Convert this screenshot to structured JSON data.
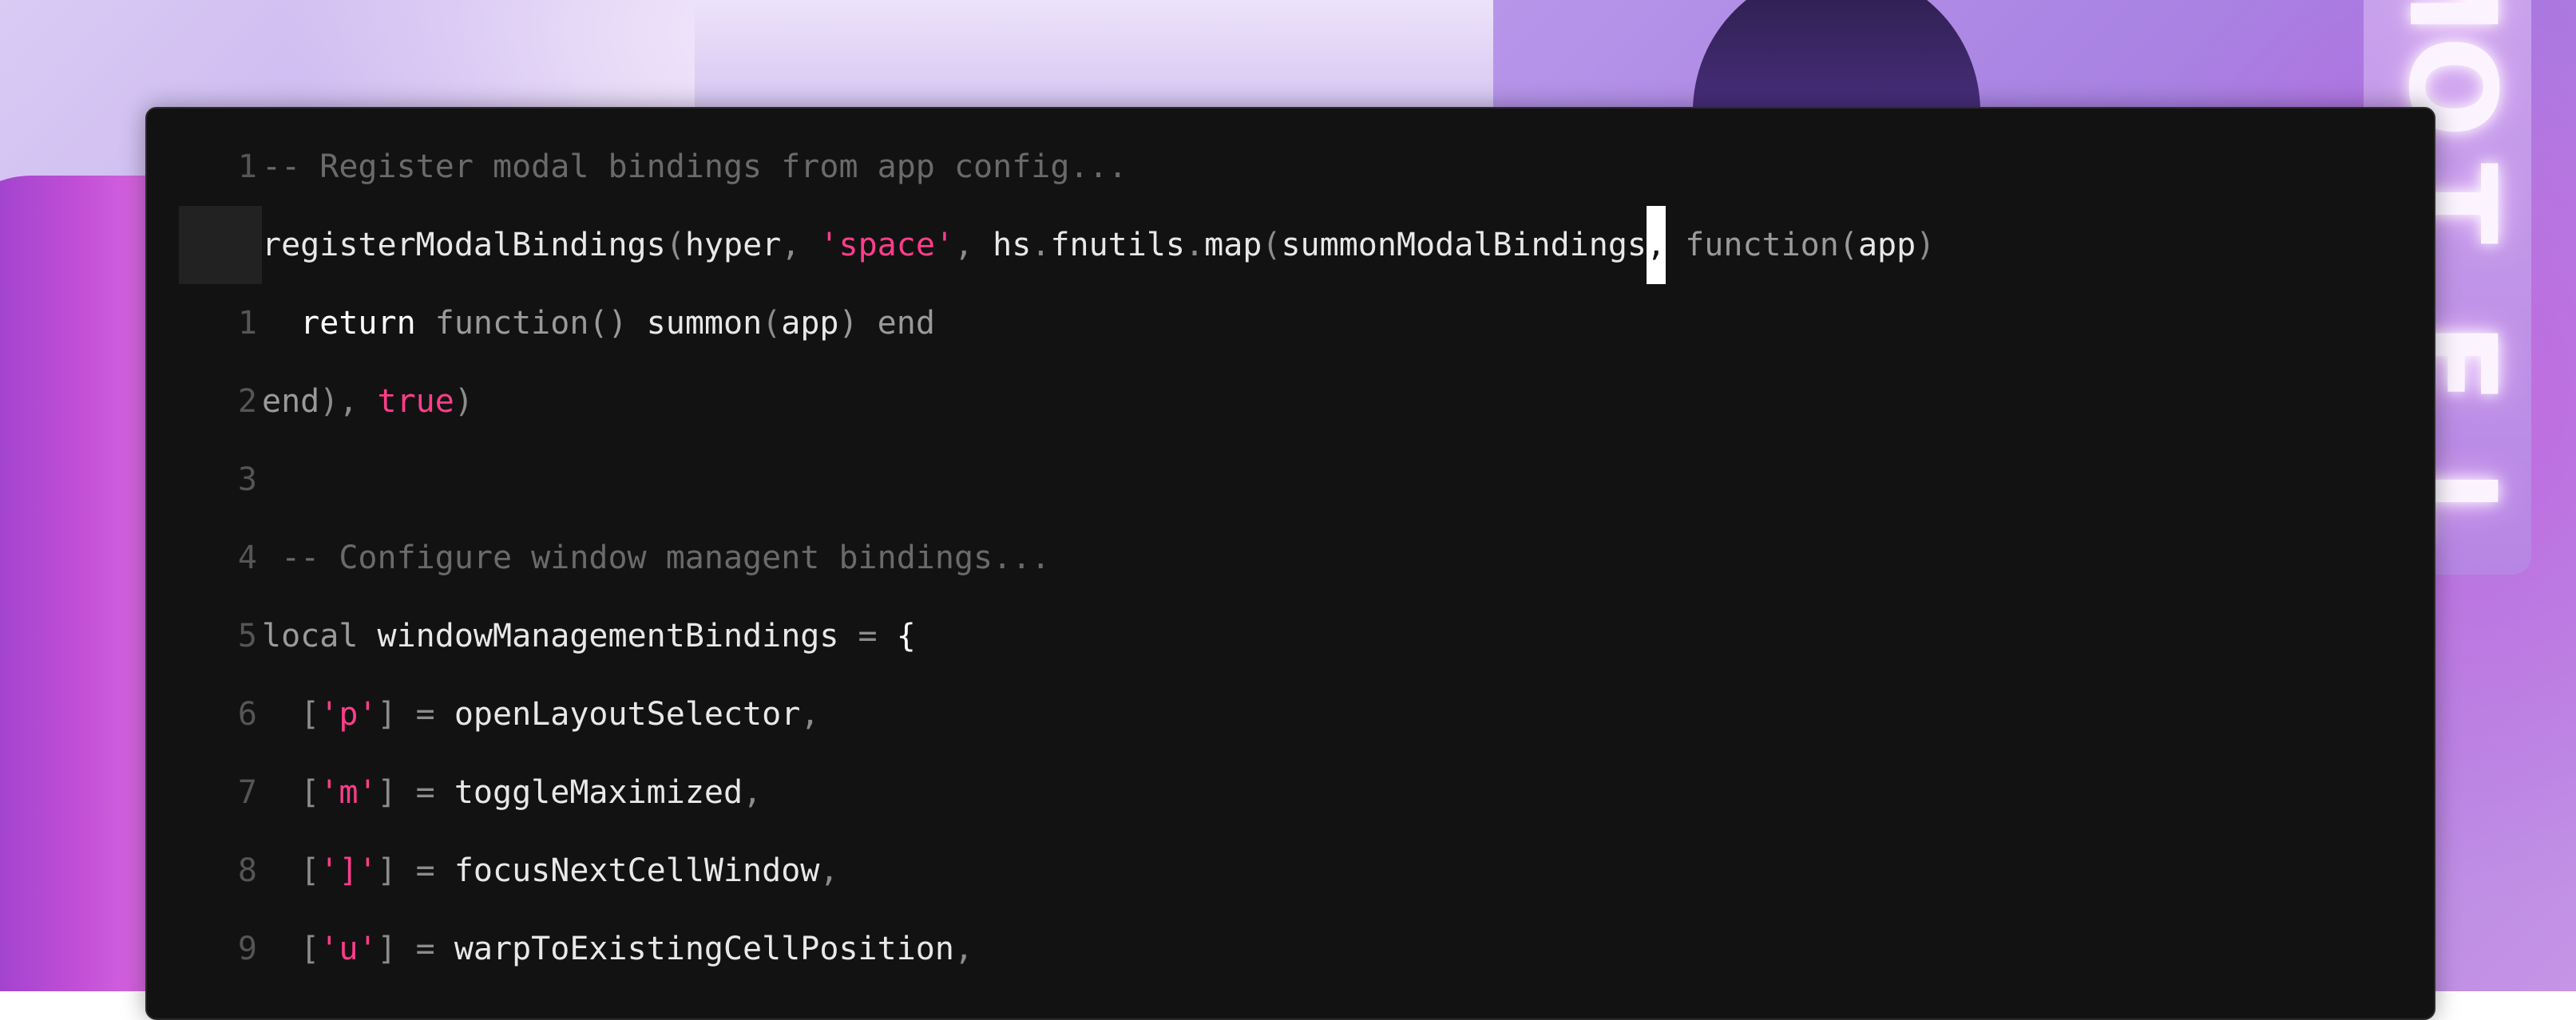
{
  "background": {
    "sign_letters": [
      "M",
      "O",
      "T",
      "E",
      "L"
    ]
  },
  "editor": {
    "lines": [
      {
        "number": "1",
        "active": false,
        "tokens": [
          {
            "t": "-- Register modal bindings from app config...",
            "c": "comment"
          }
        ]
      },
      {
        "number": "",
        "active": true,
        "tokens": [
          {
            "t": "registerModalBindings",
            "c": ""
          },
          {
            "t": "(",
            "c": "punct"
          },
          {
            "t": "hyper",
            "c": ""
          },
          {
            "t": ", ",
            "c": "punct"
          },
          {
            "t": "'space'",
            "c": "str"
          },
          {
            "t": ", ",
            "c": "punct"
          },
          {
            "t": "hs",
            "c": ""
          },
          {
            "t": ".",
            "c": "punct"
          },
          {
            "t": "fnutils",
            "c": ""
          },
          {
            "t": ".",
            "c": "punct"
          },
          {
            "t": "map",
            "c": ""
          },
          {
            "t": "(",
            "c": "punct"
          },
          {
            "t": "summonModalBindings",
            "c": ""
          },
          {
            "t": ",",
            "c": "cursor"
          },
          {
            "t": " function(",
            "c": "dim"
          },
          {
            "t": "app",
            "c": ""
          },
          {
            "t": ")",
            "c": "punct"
          }
        ]
      },
      {
        "number": "1",
        "active": false,
        "tokens": [
          {
            "t": "  ",
            "c": ""
          },
          {
            "t": "return",
            "c": "key"
          },
          {
            "t": " function() ",
            "c": "dim"
          },
          {
            "t": "summon",
            "c": ""
          },
          {
            "t": "(",
            "c": "punct"
          },
          {
            "t": "app",
            "c": ""
          },
          {
            "t": ") end",
            "c": "dim"
          }
        ]
      },
      {
        "number": "2",
        "active": false,
        "tokens": [
          {
            "t": "end",
            "c": "dim"
          },
          {
            "t": "), ",
            "c": "punct"
          },
          {
            "t": "true",
            "c": "kwd"
          },
          {
            "t": ")",
            "c": "punct"
          }
        ]
      },
      {
        "number": "3",
        "active": false,
        "tokens": []
      },
      {
        "number": "4",
        "active": false,
        "tokens": [
          {
            "t": " -- Configure window managent bindings...",
            "c": "comment"
          }
        ]
      },
      {
        "number": "5",
        "active": false,
        "tokens": [
          {
            "t": "local ",
            "c": "dim"
          },
          {
            "t": "windowManagementBindings",
            "c": ""
          },
          {
            "t": " = ",
            "c": "punct"
          },
          {
            "t": "{",
            "c": "key"
          }
        ]
      },
      {
        "number": "6",
        "active": false,
        "tokens": [
          {
            "t": "  [",
            "c": "punct"
          },
          {
            "t": "'p'",
            "c": "str"
          },
          {
            "t": "] = ",
            "c": "punct"
          },
          {
            "t": "openLayoutSelector",
            "c": ""
          },
          {
            "t": ",",
            "c": "punct"
          }
        ]
      },
      {
        "number": "7",
        "active": false,
        "tokens": [
          {
            "t": "  [",
            "c": "punct"
          },
          {
            "t": "'m'",
            "c": "str"
          },
          {
            "t": "] = ",
            "c": "punct"
          },
          {
            "t": "toggleMaximized",
            "c": ""
          },
          {
            "t": ",",
            "c": "punct"
          }
        ]
      },
      {
        "number": "8",
        "active": false,
        "tokens": [
          {
            "t": "  [",
            "c": "punct"
          },
          {
            "t": "']'",
            "c": "str"
          },
          {
            "t": "] = ",
            "c": "punct"
          },
          {
            "t": "focusNextCellWindow",
            "c": ""
          },
          {
            "t": ",",
            "c": "punct"
          }
        ]
      },
      {
        "number": "9",
        "active": false,
        "tokens": [
          {
            "t": "  [",
            "c": "punct"
          },
          {
            "t": "'u'",
            "c": "str"
          },
          {
            "t": "] = ",
            "c": "punct"
          },
          {
            "t": "warpToExistingCellPosition",
            "c": ""
          },
          {
            "t": ",",
            "c": "punct"
          }
        ]
      }
    ]
  }
}
